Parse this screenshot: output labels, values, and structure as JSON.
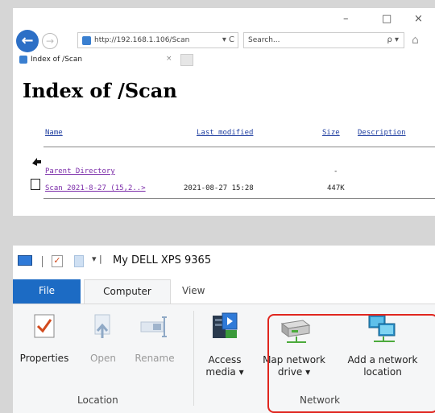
{
  "browser": {
    "window_controls": {
      "minimize": "–",
      "maximize": "□",
      "close": "×"
    },
    "address": "http://192.168.1.106/Scan",
    "address_controls": "▾ C",
    "search_placeholder": "Search...",
    "search_controls": "ρ ▾",
    "tab_title": "Index of /Scan",
    "tab_close": "×",
    "page_title": "Index of /Scan",
    "columns": {
      "name": "Name",
      "last_modified": "Last modified",
      "size": "Size",
      "description": "Description"
    },
    "rows": [
      {
        "name": "Parent Directory",
        "last_modified": "",
        "size": "-"
      },
      {
        "name": "Scan 2021-8-27 (15,2..>",
        "last_modified": "2021-08-27 15:28",
        "size": "447K"
      }
    ]
  },
  "explorer": {
    "quick_access_dropdown": "▾ |",
    "window_title": "My DELL XPS 9365",
    "tabs": {
      "file": "File",
      "computer": "Computer",
      "view": "View"
    },
    "buttons": {
      "properties": "Properties",
      "open": "Open",
      "rename": "Rename",
      "access_media_line1": "Access",
      "access_media_line2": "media ▾",
      "map_drive_line1": "Map network",
      "map_drive_line2": "drive ▾",
      "add_location_line1": "Add a network",
      "add_location_line2": "location"
    },
    "groups": {
      "location": "Location",
      "network": "Network"
    },
    "highlight_color": "#e0261f",
    "accent_color": "#1c6bc4"
  }
}
